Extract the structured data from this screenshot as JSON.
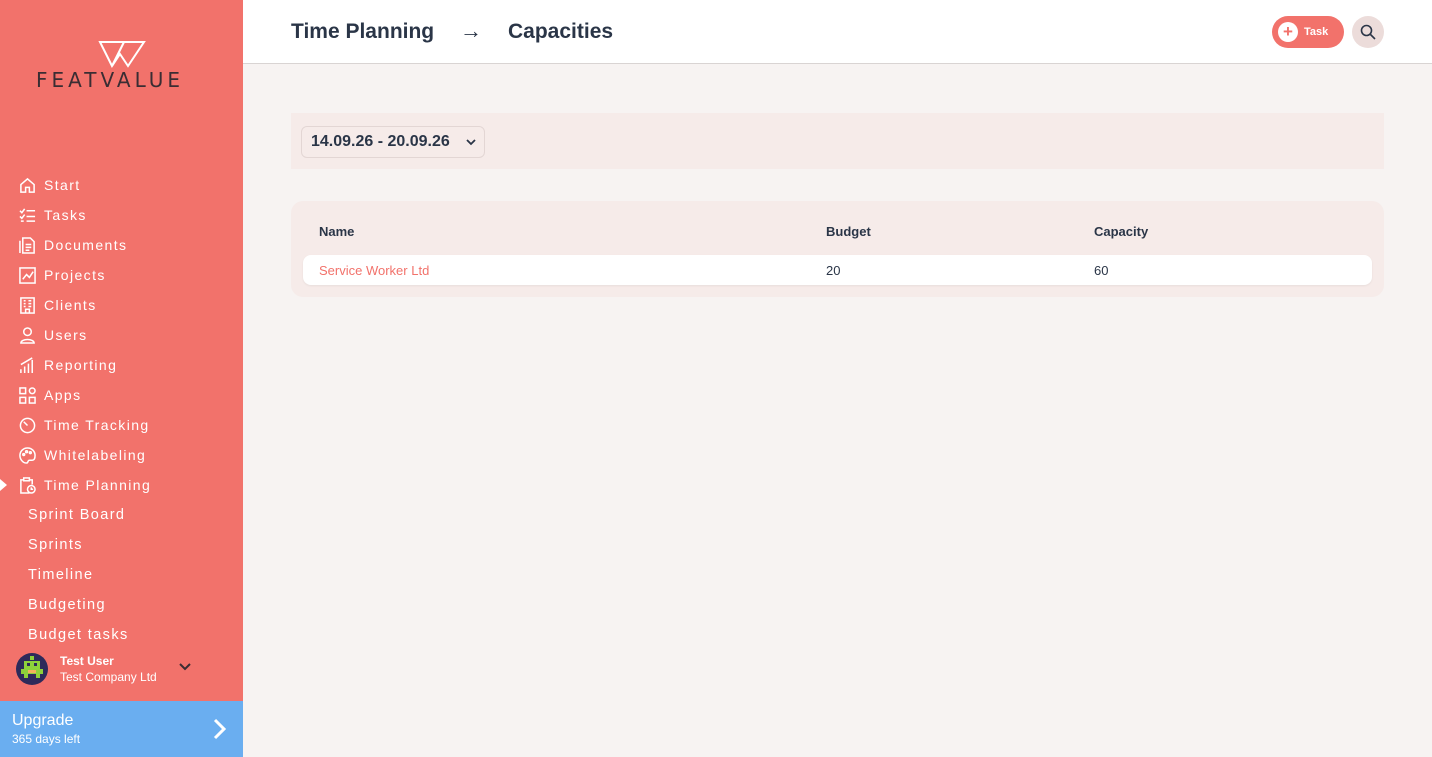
{
  "brand": {
    "name": "FEATVALUE",
    "accent": "#f2726b",
    "upgrade_color": "#6aaef0"
  },
  "sidebar": {
    "items": [
      {
        "label": "Start",
        "icon": "home-icon"
      },
      {
        "label": "Tasks",
        "icon": "checklist-icon"
      },
      {
        "label": "Documents",
        "icon": "documents-icon"
      },
      {
        "label": "Projects",
        "icon": "projects-chart-icon"
      },
      {
        "label": "Clients",
        "icon": "building-icon"
      },
      {
        "label": "Users",
        "icon": "user-icon"
      },
      {
        "label": "Reporting",
        "icon": "bar-chart-icon"
      },
      {
        "label": "Apps",
        "icon": "apps-grid-icon"
      },
      {
        "label": "Time Tracking",
        "icon": "timer-icon"
      },
      {
        "label": "Whitelabeling",
        "icon": "palette-icon"
      },
      {
        "label": "Time Planning",
        "icon": "clipboard-clock-icon",
        "active": true
      }
    ],
    "sub_items": [
      "Sprint Board",
      "Sprints",
      "Timeline",
      "Budgeting",
      "Budget tasks"
    ]
  },
  "user": {
    "name": "Test User",
    "company": "Test Company Ltd"
  },
  "upgrade": {
    "title": "Upgrade",
    "subtitle": "365 days left"
  },
  "header": {
    "breadcrumb": [
      "Time Planning",
      "Capacities"
    ],
    "arrow": "→",
    "task_button": "Task",
    "plus": "+"
  },
  "filter": {
    "week": "14.09.26 - 20.09.26"
  },
  "table": {
    "columns": [
      "Name",
      "Budget",
      "Capacity"
    ],
    "rows": [
      {
        "name": "Service Worker Ltd",
        "budget": "20",
        "capacity": "60"
      }
    ]
  }
}
